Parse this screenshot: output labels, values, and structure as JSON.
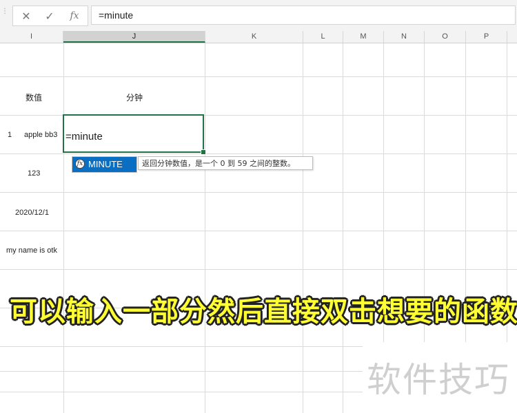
{
  "formula_bar": {
    "cancel_icon": "✕",
    "enter_icon": "✓",
    "fx_label": "fx",
    "formula": "=minute"
  },
  "columns": [
    {
      "label": "I",
      "selected": false
    },
    {
      "label": "J",
      "selected": true
    },
    {
      "label": "K",
      "selected": false
    },
    {
      "label": "L",
      "selected": false
    },
    {
      "label": "M",
      "selected": false
    },
    {
      "label": "N",
      "selected": false
    },
    {
      "label": "O",
      "selected": false
    },
    {
      "label": "P",
      "selected": false
    }
  ],
  "cells": {
    "i_header": "数值",
    "j_header": "分钟",
    "row_number": "1",
    "i_apple": "apple bb3",
    "i_123": "123",
    "i_date": "2020/12/1",
    "i_name": "my name is otk"
  },
  "active_cell": {
    "text": "=minute"
  },
  "autocomplete": {
    "icon_label": "fx",
    "item": "MINUTE",
    "tooltip": "返回分钟数值，是一个 0 到 59 之间的整数。"
  },
  "caption": "可以输入一部分然后直接双击想要的函数",
  "watermark": "软件技巧",
  "colors": {
    "accent_green": "#217346",
    "select_blue": "#0a6fc2",
    "caption_yellow": "#ffff33"
  }
}
